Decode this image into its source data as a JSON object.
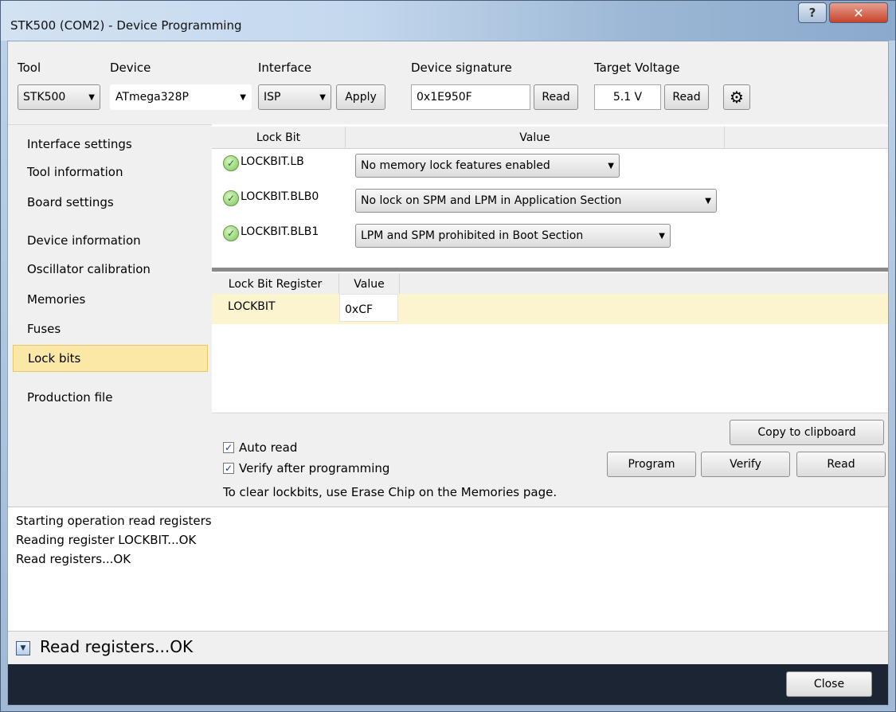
{
  "window": {
    "title": "STK500 (COM2) - Device Programming",
    "help_label": "?",
    "close_label": "✕"
  },
  "toolbar": {
    "tool_label": "Tool",
    "tool_value": "STK500",
    "device_label": "Device",
    "device_value": "ATmega328P",
    "interface_label": "Interface",
    "interface_value": "ISP",
    "apply_label": "Apply",
    "signature_label": "Device signature",
    "signature_value": "0x1E950F",
    "signature_read_label": "Read",
    "voltage_label": "Target Voltage",
    "voltage_value": "5.1 V",
    "voltage_read_label": "Read"
  },
  "nav": {
    "items": [
      {
        "label": "Interface settings"
      },
      {
        "label": "Tool information"
      },
      {
        "label": "Board settings"
      },
      {
        "label": "Device information"
      },
      {
        "label": "Oscillator calibration"
      },
      {
        "label": "Memories"
      },
      {
        "label": "Fuses"
      },
      {
        "label": "Lock bits"
      },
      {
        "label": "Production file"
      }
    ],
    "active": "Lock bits"
  },
  "lockbits": {
    "col_name": "Lock Bit",
    "col_value": "Value",
    "rows": [
      {
        "name": "LOCKBIT.LB",
        "value": "No memory lock features enabled"
      },
      {
        "name": "LOCKBIT.BLB0",
        "value": "No lock on SPM and LPM in Application Section"
      },
      {
        "name": "LOCKBIT.BLB1",
        "value": "LPM and SPM prohibited in Boot Section"
      }
    ]
  },
  "register": {
    "col_name": "Lock Bit Register",
    "col_value": "Value",
    "name": "LOCKBIT",
    "value": "0xCF"
  },
  "options": {
    "auto_read_label": "Auto read",
    "auto_read_checked": true,
    "verify_label": "Verify after programming",
    "verify_checked": true,
    "copy_label": "Copy to clipboard",
    "program_label": "Program",
    "verify_button_label": "Verify",
    "read_label": "Read",
    "hint": "To clear lockbits, use Erase Chip on the Memories page."
  },
  "log": {
    "lines": [
      "Starting operation read registers",
      "Reading register LOCKBIT...OK",
      "Read registers...OK"
    ]
  },
  "status": {
    "text": "Read registers...OK"
  },
  "footer": {
    "close_label": "Close"
  },
  "icons": {
    "check_mark": "✓",
    "dropdown_arrow": "▼",
    "gear": "⚙"
  }
}
